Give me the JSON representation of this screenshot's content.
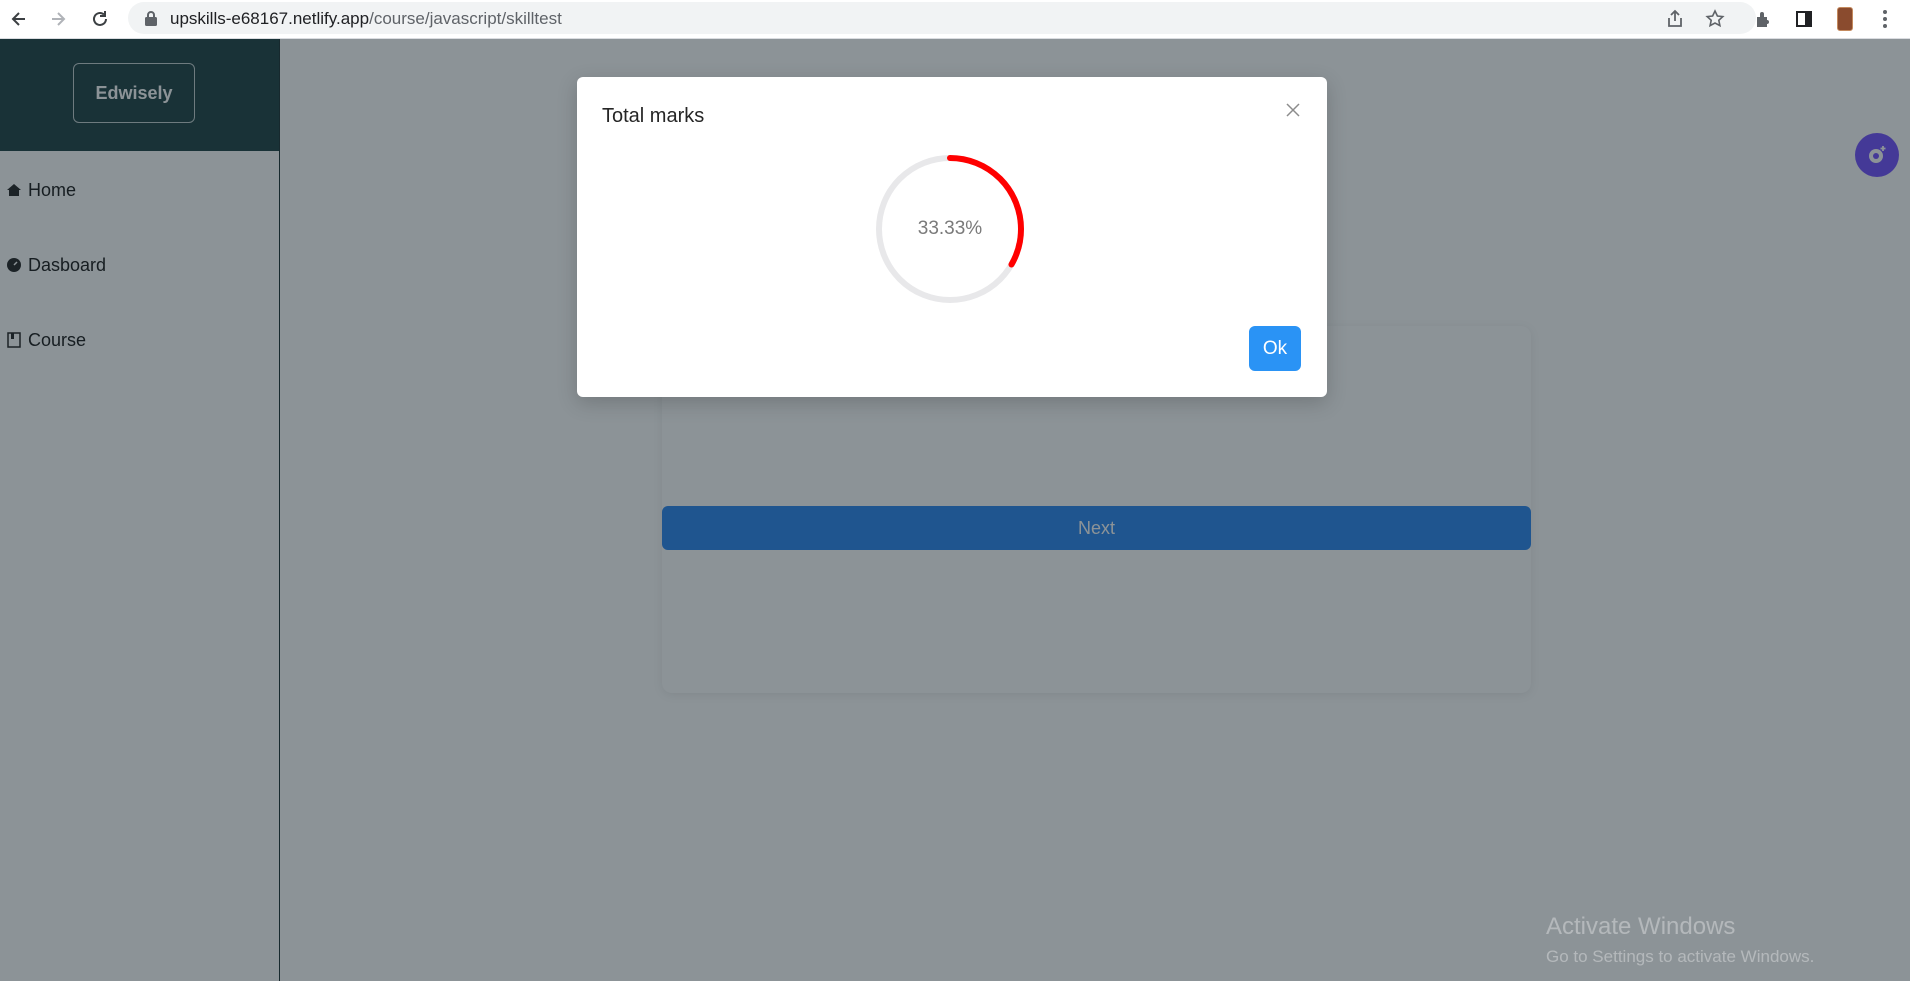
{
  "browser": {
    "url_host": "upskills-e68167.netlify.app",
    "url_path": "/course/javascript/skilltest"
  },
  "sidebar": {
    "brand": "Edwisely",
    "items": [
      {
        "label": "Home",
        "icon": "home-icon"
      },
      {
        "label": "Dasboard",
        "icon": "dashboard-icon"
      },
      {
        "label": "Course",
        "icon": "book-icon"
      }
    ]
  },
  "main": {
    "next_label": "Next"
  },
  "modal": {
    "title": "Total marks",
    "progress_percent": 33.33,
    "progress_text": "33.33%",
    "ok_label": "Ok",
    "progress_color": "#ff0000",
    "track_color": "#e8e8ea"
  },
  "watermark": {
    "title": "Activate Windows",
    "subtitle": "Go to Settings to activate Windows."
  }
}
